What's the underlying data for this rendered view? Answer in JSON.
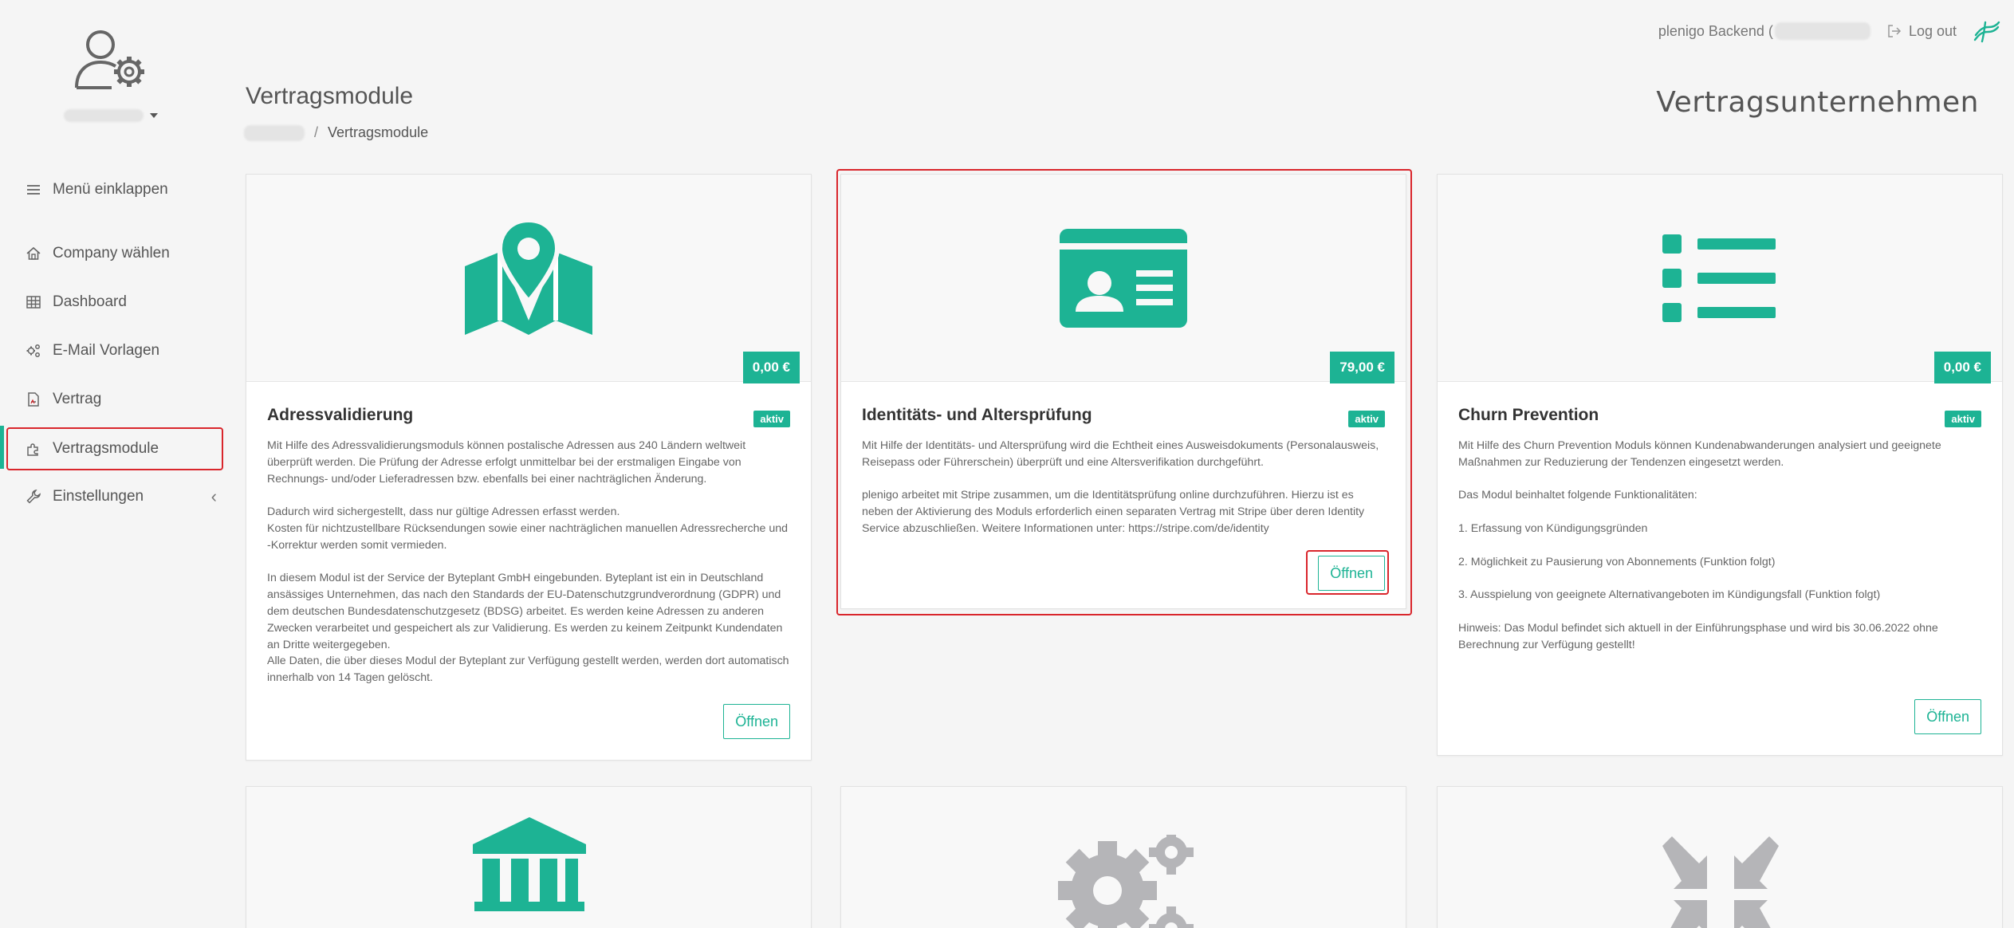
{
  "topbar": {
    "backend_label": "plenigo Backend (",
    "logout_label": "Log out"
  },
  "sidebar": {
    "collapse_label": "Menü einklappen",
    "items": [
      {
        "label": "Company wählen",
        "icon": "home-icon"
      },
      {
        "label": "Dashboard",
        "icon": "grid-icon"
      },
      {
        "label": "E-Mail Vorlagen",
        "icon": "gears-icon"
      },
      {
        "label": "Vertrag",
        "icon": "document-icon"
      },
      {
        "label": "Vertragsmodule",
        "icon": "puzzle-icon"
      },
      {
        "label": "Einstellungen",
        "icon": "wrench-icon"
      }
    ]
  },
  "header": {
    "title": "Vertragsmodule",
    "breadcrumb_current": "Vertragsmodule",
    "company_title": "Vertragsunternehmen"
  },
  "colors": {
    "accent": "#1db394",
    "highlight": "#d9262c",
    "inactive_icon": "#b5b5b8"
  },
  "cards": [
    {
      "icon": "map-pin-icon",
      "price": "0,00 €",
      "title": "Adressvalidierung",
      "status": "aktiv",
      "paragraphs": [
        "Mit Hilfe des Adressvalidierungsmoduls können postalische Adressen aus 240 Ländern weltweit überprüft werden. Die Prüfung der Adresse erfolgt unmittelbar bei der erstmaligen Eingabe von Rechnungs- und/oder Lieferadressen bzw. ebenfalls bei einer nachträglichen Änderung.",
        "Dadurch wird sichergestellt, dass nur gültige Adressen erfasst werden.",
        "Kosten für nichtzustellbare Rücksendungen sowie einer nachträglichen manuellen Adressrecherche und -Korrektur werden somit vermieden.",
        "In diesem Modul ist der Service der Byteplant GmbH eingebunden. Byteplant ist ein in Deutschland ansässiges Unternehmen, das nach den Standards der EU-Datenschutzgrundverordnung (GDPR) und dem deutschen Bundesdatenschutzgesetz (BDSG) arbeitet. Es werden keine Adressen zu anderen Zwecken verarbeitet und gespeichert als zur Validierung. Es werden zu keinem Zeitpunkt Kundendaten an Dritte weitergegeben.",
        "Alle Daten, die über dieses Modul der Byteplant zur Verfügung gestellt werden, werden dort automatisch innerhalb von 14 Tagen gelöscht."
      ],
      "button": "Öffnen"
    },
    {
      "icon": "id-card-icon",
      "price": "79,00 €",
      "title": "Identitäts- und Altersprüfung",
      "status": "aktiv",
      "paragraphs": [
        "Mit Hilfe der Identitäts- und Altersprüfung wird die Echtheit eines Ausweisdokuments (Personalausweis, Reisepass oder Führerschein) überprüft und eine Altersverifikation durchgeführt.",
        "plenigo arbeitet mit Stripe zusammen, um die Identitätsprüfung online durchzuführen. Hierzu ist es neben der Aktivierung des Moduls erforderlich einen separaten Vertrag mit Stripe über deren Identity Service abzuschließen. Weitere Informationen unter: https://stripe.com/de/identity"
      ],
      "button": "Öffnen"
    },
    {
      "icon": "list-icon",
      "price": "0,00 €",
      "title": "Churn Prevention",
      "status": "aktiv",
      "paragraphs": [
        "Mit Hilfe des Churn Prevention Moduls können Kundenabwanderungen analysiert und geeignete Maßnahmen zur Reduzierung der Tendenzen eingesetzt werden.",
        "Das Modul beinhaltet folgende Funktionalitäten:",
        "1. Erfassung von Kündigungsgründen",
        "2. Möglichkeit zu Pausierung von Abonnements (Funktion folgt)",
        "3. Ausspielung von geeignete Alternativangeboten im Kündigungsfall (Funktion folgt)",
        "Hinweis: Das Modul befindet sich aktuell in der Einführungsphase und wird bis 30.06.2022 ohne Berechnung zur Verfügung gestellt!"
      ],
      "button": "Öffnen"
    }
  ],
  "bottom_cards": [
    {
      "icon": "bank-icon"
    },
    {
      "icon": "gears-icon"
    },
    {
      "icon": "compress-arrows-icon"
    }
  ]
}
